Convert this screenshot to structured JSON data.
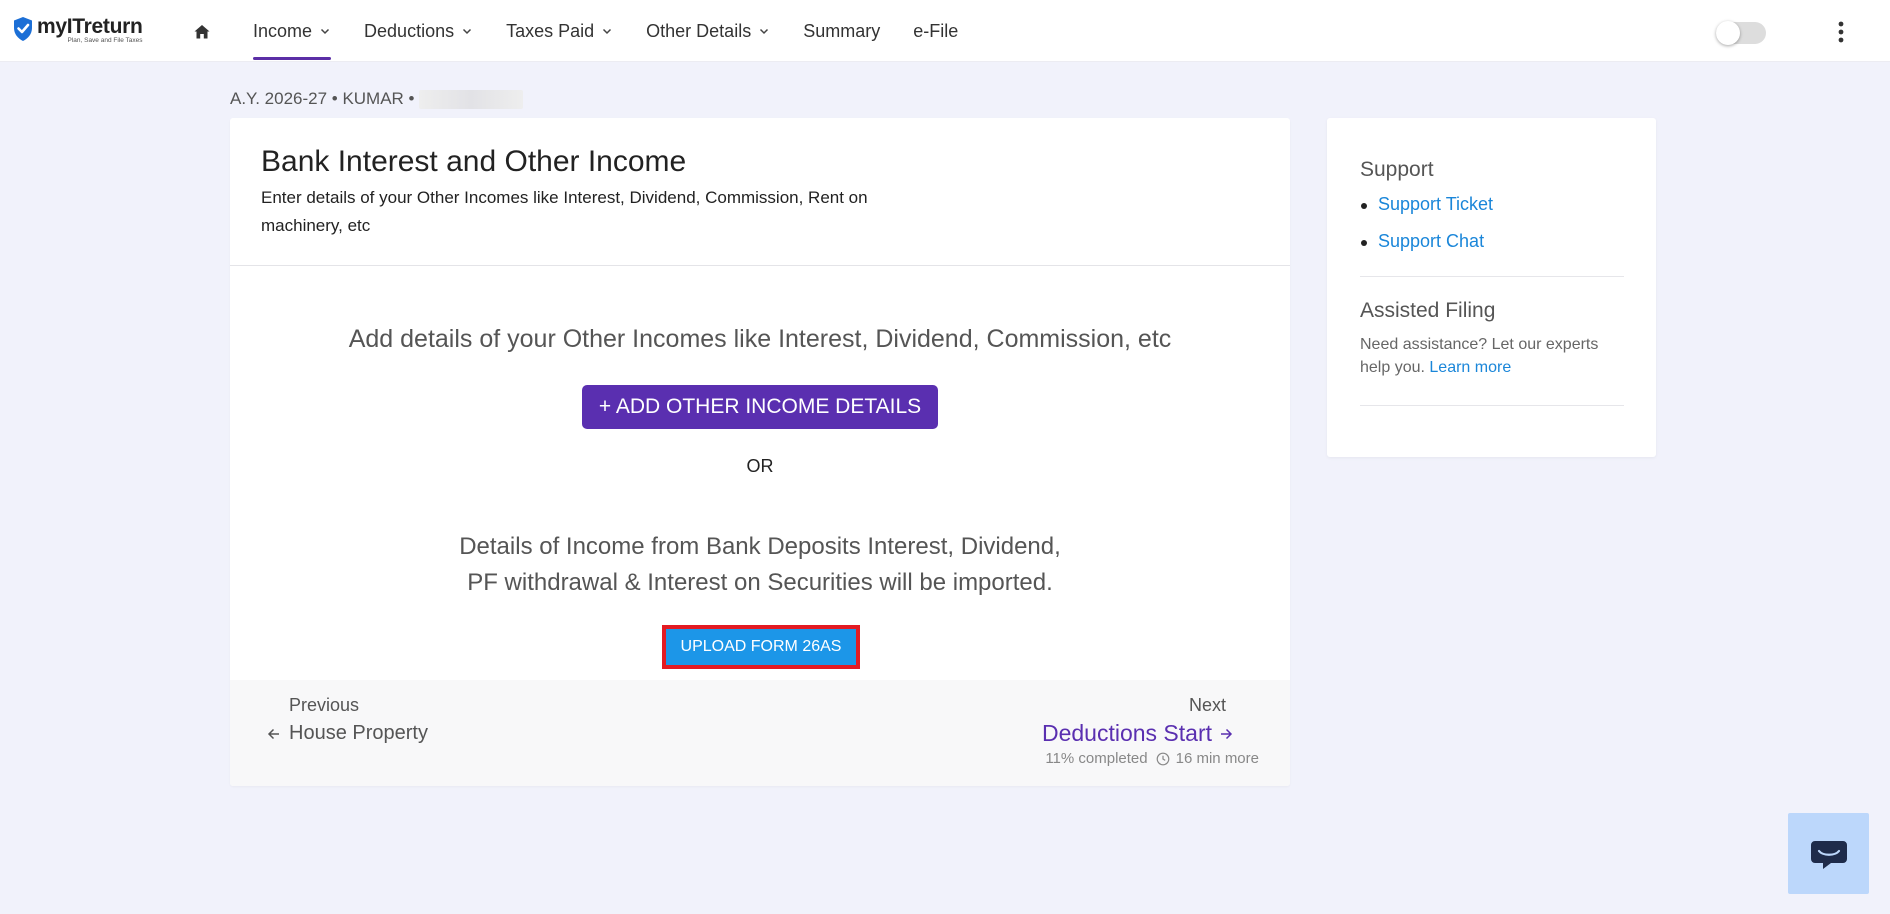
{
  "brand": {
    "name": "myITreturn",
    "tagline": "Plan, Save and File Taxes",
    "accent_color": "#5a2fb0",
    "link_color": "#1a86d9"
  },
  "nav": {
    "items": [
      {
        "label": "Income",
        "has_dropdown": true,
        "active": true
      },
      {
        "label": "Deductions",
        "has_dropdown": true,
        "active": false
      },
      {
        "label": "Taxes Paid",
        "has_dropdown": true,
        "active": false
      },
      {
        "label": "Other Details",
        "has_dropdown": true,
        "active": false
      },
      {
        "label": "Summary",
        "has_dropdown": false,
        "active": false
      },
      {
        "label": "e-File",
        "has_dropdown": false,
        "active": false
      }
    ]
  },
  "breadcrumb": {
    "text": "A.Y. 2026-27 • KUMAR •"
  },
  "main": {
    "title": "Bank Interest and Other Income",
    "description": "Enter details of your Other Incomes like Interest, Dividend, Commission, Rent on machinery, etc",
    "prompt": "Add details of your Other Incomes like Interest, Dividend, Commission, etc",
    "add_button": "+ ADD OTHER INCOME DETAILS",
    "or_label": "OR",
    "import_line_1": "Details of Income from Bank Deposits Interest, Dividend,",
    "import_line_2": "PF withdrawal & Interest on Securities will be imported.",
    "upload_button": "UPLOAD FORM 26AS"
  },
  "footer": {
    "previous_label": "Previous",
    "previous_link": "House Property",
    "next_label": "Next",
    "next_link": "Deductions Start",
    "completion": "11% completed",
    "time_left": "16 min more"
  },
  "sidebar": {
    "support_title": "Support",
    "support_links": [
      "Support Ticket",
      "Support Chat"
    ],
    "assisted_title": "Assisted Filing",
    "assisted_text": "Need assistance? Let our experts help you.",
    "assisted_link": "Learn more"
  },
  "icons": {
    "home": "home-icon",
    "menu": "kebab-menu-icon",
    "chat": "chat-icon"
  }
}
